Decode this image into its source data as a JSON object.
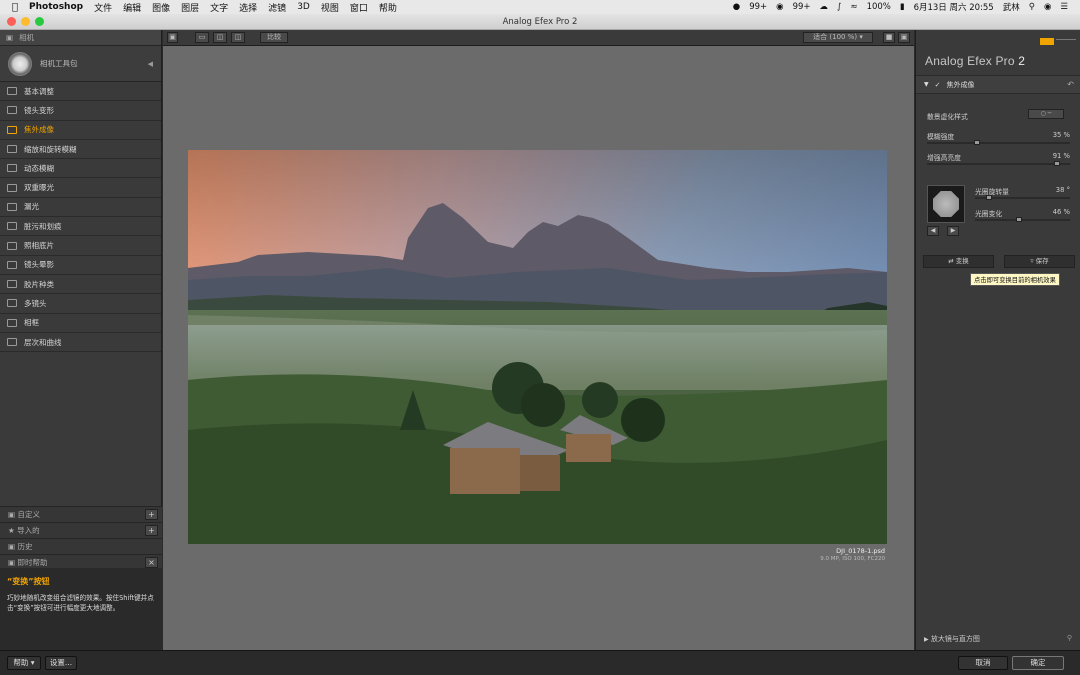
{
  "menubar": {
    "app": "Photoshop",
    "menus": [
      "文件",
      "编辑",
      "图像",
      "图层",
      "文字",
      "选择",
      "滤镜",
      "3D",
      "视图",
      "窗口",
      "帮助"
    ],
    "status_qq": "99+",
    "status_wechat": "99+",
    "battery": "100%",
    "datetime": "6月13日 周六  20:55",
    "user": "武林"
  },
  "window": {
    "title": "Analog Efex Pro 2"
  },
  "left": {
    "header": "相机",
    "toolbox": "相机工具包",
    "filters": [
      {
        "label": "基本调整",
        "active": false
      },
      {
        "label": "镜头变形",
        "active": false
      },
      {
        "label": "焦外成像",
        "active": true
      },
      {
        "label": "缩放和旋转模糊",
        "active": false
      },
      {
        "label": "动态模糊",
        "active": false
      },
      {
        "label": "双重曝光",
        "active": false
      },
      {
        "label": "漏光",
        "active": false
      },
      {
        "label": "脏污和划痕",
        "active": false
      },
      {
        "label": "照相底片",
        "active": false
      },
      {
        "label": "镜头晕影",
        "active": false
      },
      {
        "label": "胶片种类",
        "active": false
      },
      {
        "label": "多镜头",
        "active": false
      },
      {
        "label": "相框",
        "active": false
      },
      {
        "label": "层次和曲线",
        "active": false
      }
    ],
    "custom": "自定义",
    "imported": "导入的",
    "history": "历史",
    "instant_help": "即时帮助",
    "help_title": "“变换”按钮",
    "help_body": "巧妙地随机改变组合滤镜的效果。按住Shift键并点击“变换”按钮可进行幅度更大地调整。"
  },
  "center": {
    "compare": "比较",
    "zoom": "适合 (100 %)",
    "file_name": "DJI_0178-1.psd",
    "file_meta": "9.0 MP, ISO 100, FC220"
  },
  "right": {
    "brand_a": "Analog Efex Pro",
    "brand_b": "2",
    "section": "焦外成像",
    "style_label": "散景虚化样式",
    "blur_label": "模糊强度",
    "blur_value": "35 %",
    "blur_level": 0.35,
    "highlight_label": "增强高亮度",
    "highlight_value": "91 %",
    "highlight_level": 0.91,
    "aperture_label": "光圈旋转量",
    "aperture_value": "38 °",
    "aperture_level": 0.15,
    "aperture_var_label": "光圈变化",
    "aperture_var_value": "46 %",
    "aperture_var_level": 0.46,
    "shuffle": "变换",
    "save": "保存",
    "tooltip": "点击即可变换目前的相机效果",
    "loupe": "放大镜与直方图"
  },
  "bottom": {
    "help": "帮助",
    "settings": "设置...",
    "cancel": "取消",
    "ok": "确定"
  },
  "colors": {
    "accent": "#f0a400",
    "panel": "#3a3a3a",
    "canvas": "#6b6b6b"
  }
}
